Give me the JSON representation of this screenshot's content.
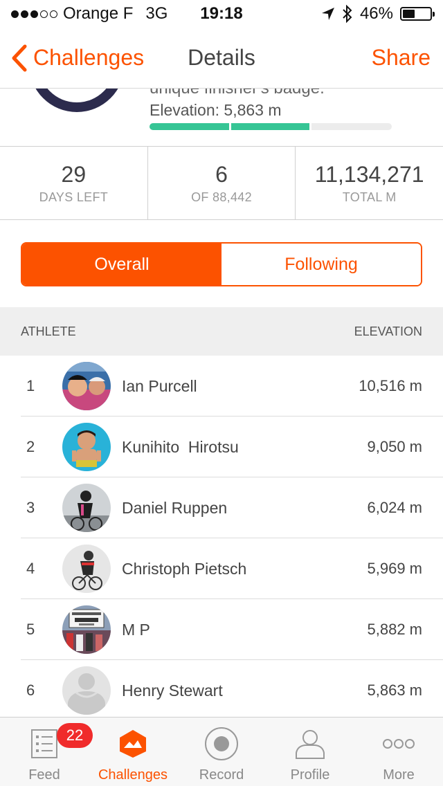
{
  "status_bar": {
    "carrier": "Orange F",
    "network": "3G",
    "time": "19:18",
    "battery_percent": "46%",
    "battery_level": 0.46
  },
  "nav": {
    "back_label": "Challenges",
    "title": "Details",
    "share_label": "Share"
  },
  "summary": {
    "cut_text": "unique finisher's badge.",
    "elevation_text": "Elevation: 5,863 m",
    "progress_fraction": 0.66,
    "progress_color": "#36c595"
  },
  "stats": [
    {
      "value": "29",
      "label": "DAYS LEFT"
    },
    {
      "value": "6",
      "label": "OF 88,442"
    },
    {
      "value": "11,134,271",
      "label": "TOTAL M"
    }
  ],
  "segments": {
    "overall": "Overall",
    "following": "Following",
    "selected": "overall"
  },
  "table": {
    "col_athlete": "ATHLETE",
    "col_elevation": "ELEVATION"
  },
  "leaderboard": [
    {
      "rank": "1",
      "name": "Ian Purcell",
      "elevation": "10,516 m"
    },
    {
      "rank": "2",
      "name": "Kunihito  Hirotsu",
      "elevation": "9,050 m"
    },
    {
      "rank": "3",
      "name": "Daniel Ruppen",
      "elevation": "6,024 m"
    },
    {
      "rank": "4",
      "name": "Christoph Pietsch",
      "elevation": "5,969 m"
    },
    {
      "rank": "5",
      "name": "M P",
      "elevation": "5,882 m"
    },
    {
      "rank": "6",
      "name": "Henry Stewart",
      "elevation": "5,863 m"
    }
  ],
  "tabs": [
    {
      "label": "Feed",
      "icon": "feed-icon",
      "badge": "22"
    },
    {
      "label": "Challenges",
      "icon": "challenges-icon",
      "active": true
    },
    {
      "label": "Record",
      "icon": "record-icon"
    },
    {
      "label": "Profile",
      "icon": "profile-icon"
    },
    {
      "label": "More",
      "icon": "more-icon"
    }
  ],
  "colors": {
    "accent": "#fc5200",
    "badge_red": "#f02b2b",
    "progress_green": "#36c595",
    "ring": "#2c2b4d"
  }
}
